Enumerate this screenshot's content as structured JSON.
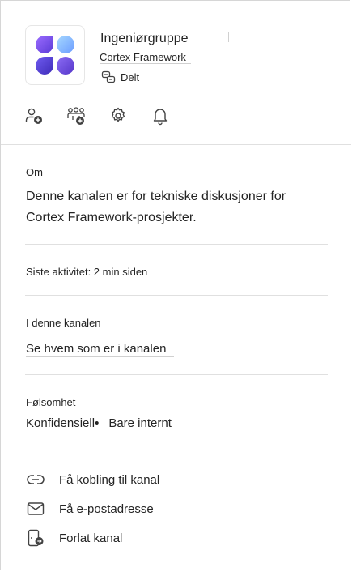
{
  "header": {
    "title": "Ingeniørgruppe",
    "subtitle": "Cortex Framework",
    "shared_label": "Delt"
  },
  "actions": {
    "icons": [
      "add-person-icon",
      "add-team-icon",
      "gear-icon",
      "bell-icon"
    ]
  },
  "about": {
    "label": "Om",
    "text_line1": "Denne kanalen er for tekniske diskusjoner for",
    "text_line2": "Cortex Framework-prosjekter."
  },
  "activity": {
    "text": "Siste aktivitet: 2 min siden"
  },
  "members": {
    "label": "I denne kanalen",
    "link": "Se hvem som er i kanalen"
  },
  "sensitivity": {
    "label": "Følsomhet",
    "value": "Konfidensiell",
    "separator": "•",
    "detail": "Bare internt"
  },
  "menu": {
    "items": [
      {
        "label": "Få kobling til kanal",
        "icon": "link-icon"
      },
      {
        "label": "Få e-postadresse",
        "icon": "mail-icon"
      },
      {
        "label": "Forlat kanal",
        "icon": "leave-icon"
      }
    ]
  },
  "colors": {
    "avatar_light": "#8fc7ff",
    "avatar_dark": "#5b3fd1",
    "avatar_mid": "#7b5cf0"
  }
}
